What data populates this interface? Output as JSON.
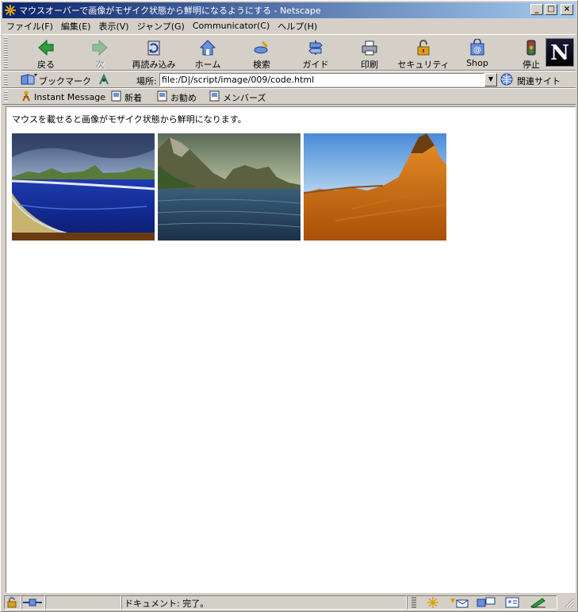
{
  "window": {
    "title": "マウスオーバーで画像がモザイク状態から鮮明になるようにする - Netscape",
    "buttons": {
      "minimize": "_",
      "maximize": "□",
      "close": "×"
    }
  },
  "menu": [
    "ファイル(F)",
    "編集(E)",
    "表示(V)",
    "ジャンプ(G)",
    "Communicator(C)",
    "ヘルプ(H)"
  ],
  "nav_toolbar": {
    "buttons": [
      {
        "label": "戻る",
        "icon": "back-arrow-icon"
      },
      {
        "label": "次",
        "icon": "forward-arrow-icon"
      },
      {
        "label": "再読み込み",
        "icon": "reload-icon"
      },
      {
        "label": "ホーム",
        "icon": "home-icon"
      },
      {
        "label": "検索",
        "icon": "search-icon"
      },
      {
        "label": "ガイド",
        "icon": "guide-icon"
      },
      {
        "label": "印刷",
        "icon": "print-icon"
      },
      {
        "label": "セキュリティ",
        "icon": "security-lock-icon"
      },
      {
        "label": "Shop",
        "icon": "shop-icon"
      },
      {
        "label": "停止",
        "icon": "stop-icon"
      }
    ],
    "logo": "N"
  },
  "location_toolbar": {
    "bookmarks_label": "ブックマーク",
    "location_label": "場所:",
    "url": "file:/D|/script/image/009/code.html",
    "related_label": "関連サイト"
  },
  "personal_toolbar": {
    "items": [
      "Instant Message",
      "新着",
      "お勧め",
      "メンバーズ"
    ]
  },
  "content": {
    "message": "マウスを載せると画像がモザイク状態から鮮明になります。"
  },
  "status": {
    "text": "ドキュメント: 完了。"
  },
  "colors": {
    "titlebar_start": "#0a246a",
    "titlebar_end": "#a6caf0",
    "chrome": "#d4d0c8"
  }
}
